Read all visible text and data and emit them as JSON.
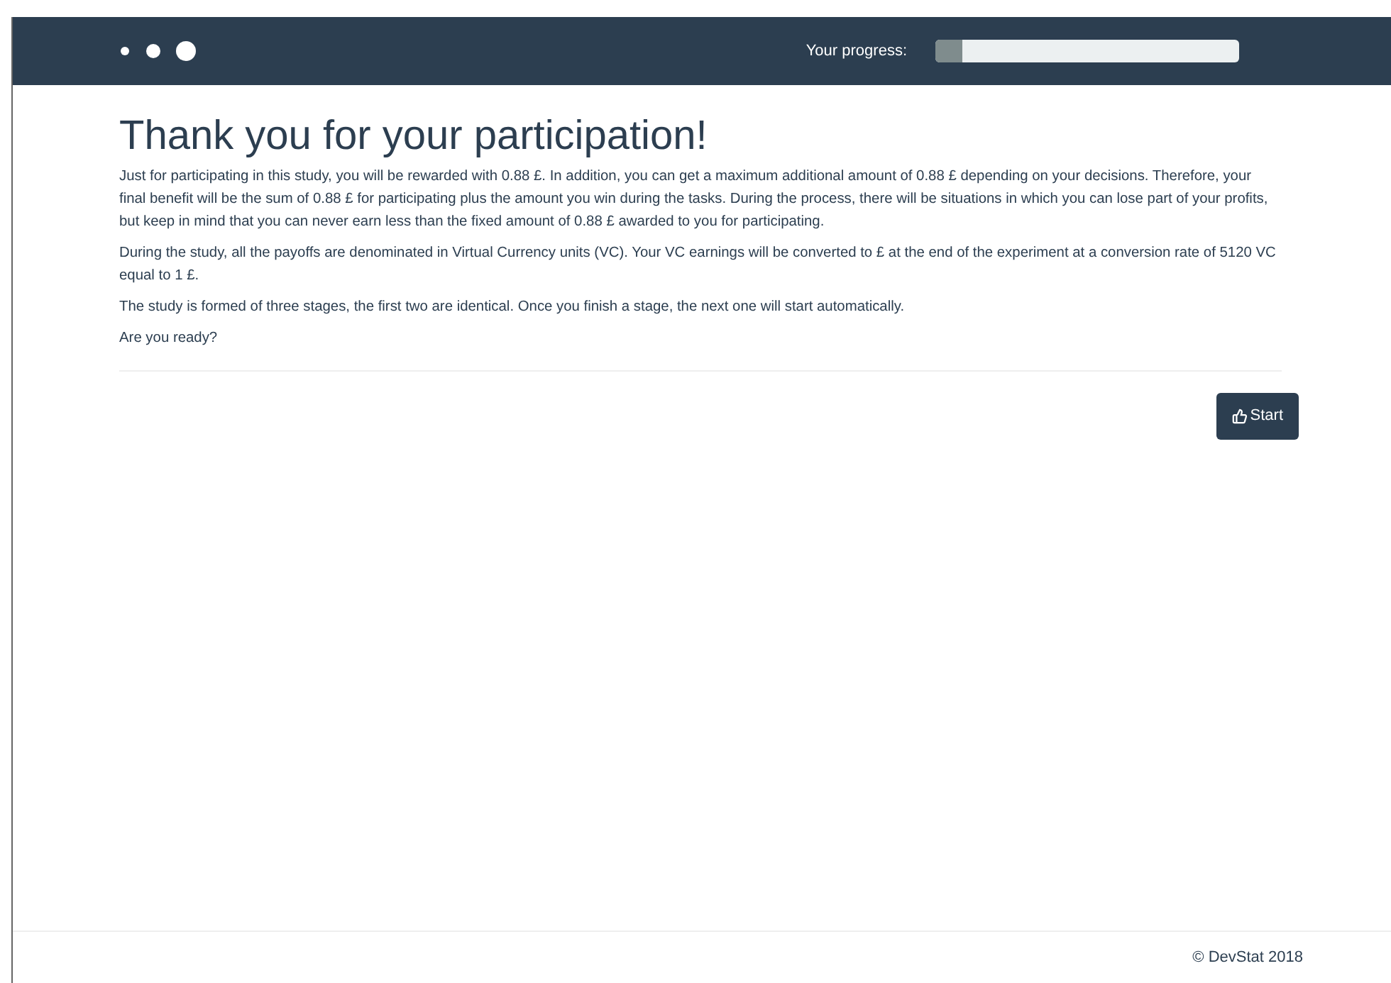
{
  "header": {
    "progress_label": "Your progress:",
    "progress": {
      "level": 0.09
    }
  },
  "title": "Thank you for your participation!",
  "paragraphs": [
    "Just for participating in this study, you will be rewarded with 0.88 £. In addition, you can get a maximum additional amount of 0.88 £ depending on your decisions. Therefore, your final benefit will be the sum of 0.88 £ for participating plus the amount you win during the tasks. During the process, there will be situations in which you can lose part of your profits, but keep in mind that you can never earn less than the fixed amount of 0.88 £ awarded to you for participating.",
    "During the study, all the payoffs are denominated in Virtual Currency units (VC). Your VC earnings will be converted to £ at the end of the experiment at a conversion rate of 5120 VC equal to 1 £.",
    "The study is formed of three stages, the first two are identical. Once you finish a stage, the next one will start automatically.",
    "Are you ready?"
  ],
  "start_button": "Start",
  "footer": "© DevStat 2018"
}
